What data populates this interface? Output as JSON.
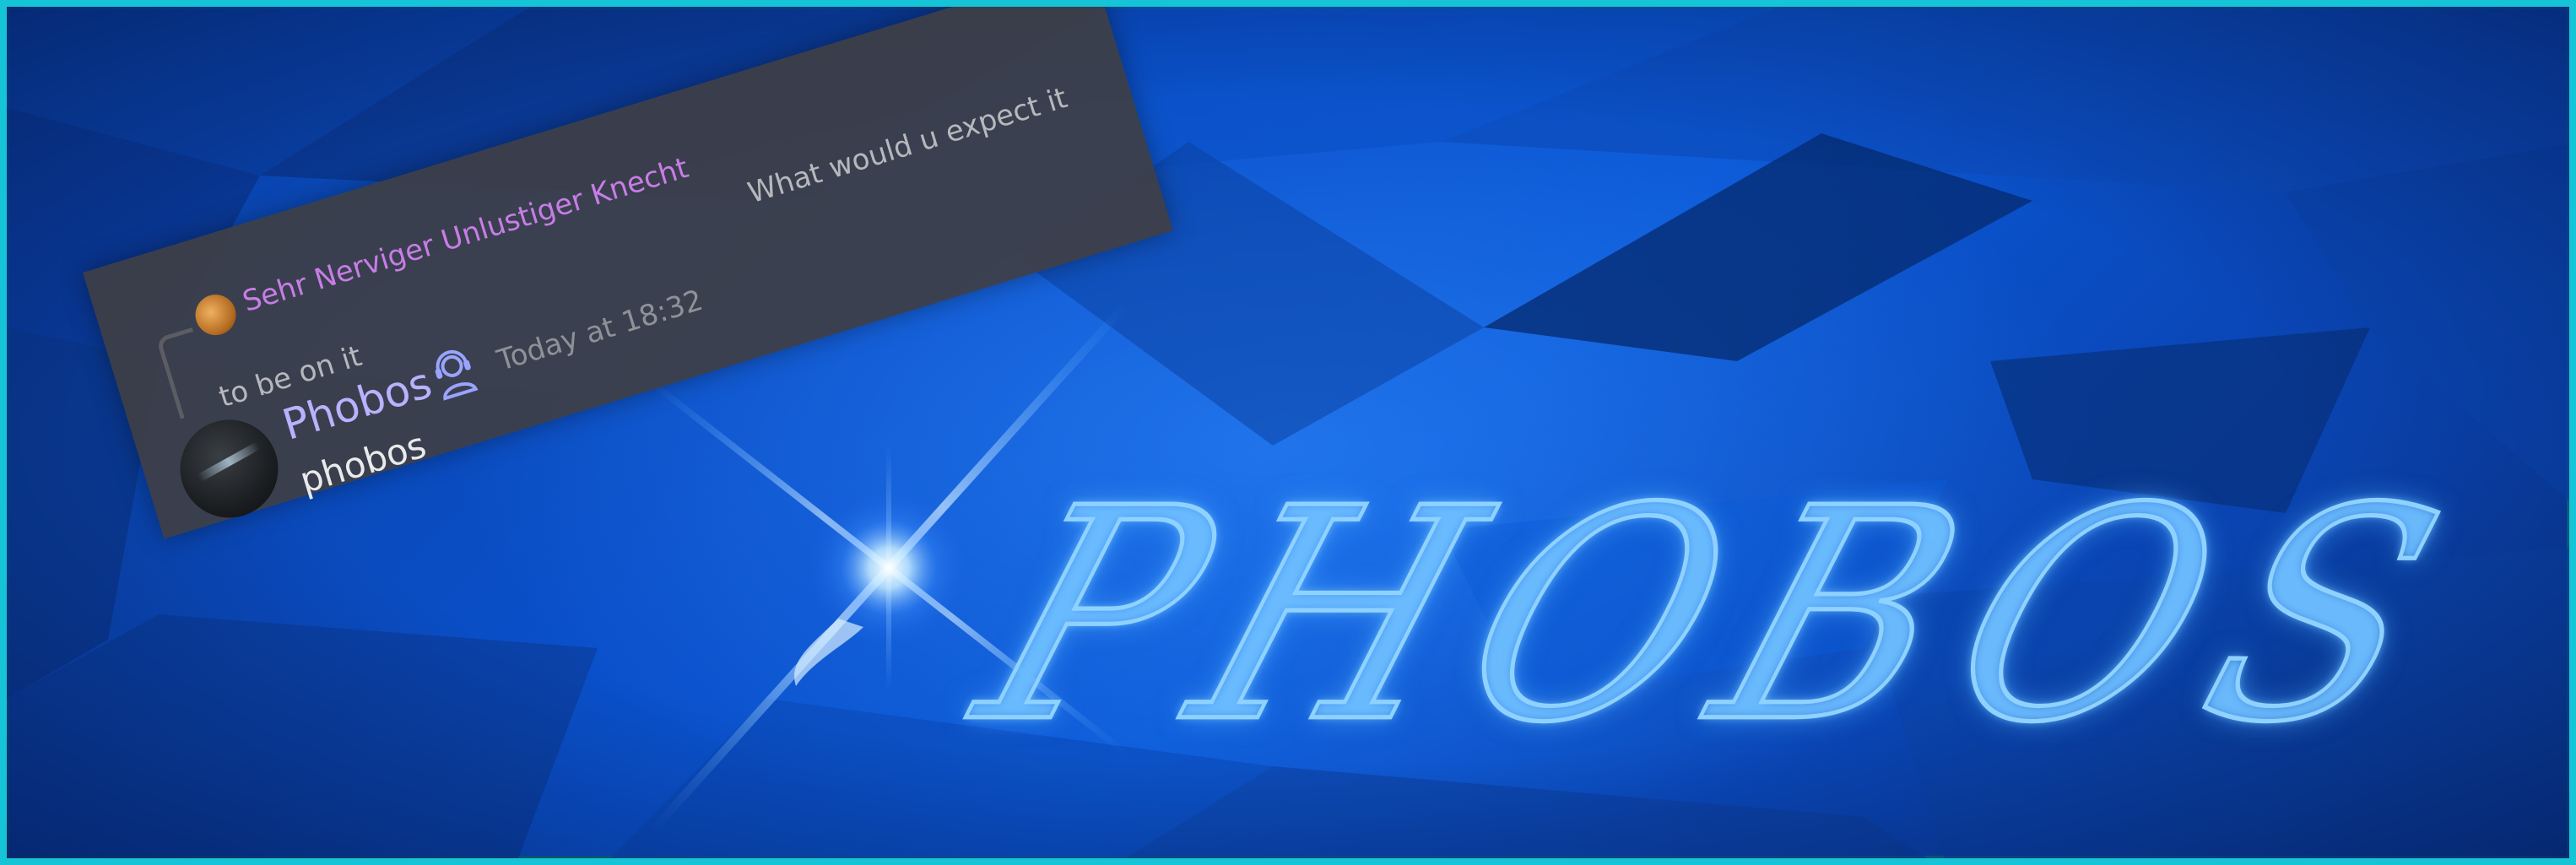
{
  "chat": {
    "reply_author": "Sehr Nerviger Unlustiger Knecht",
    "reply_text": "What would u expect it to be on it",
    "author": "Phobos",
    "timestamp": "Today at 18:32",
    "message": "phobos"
  },
  "logo_text": "PHOBOS",
  "colors": {
    "frame": "#16c4d8",
    "background": "#0a4fc9",
    "reply_author": "#c87de6",
    "author": "#b8b2ff",
    "logo_glow": "#8fd2ff"
  },
  "icons": {
    "badge": "support-headset-icon",
    "flare": "lens-flare-icon"
  }
}
